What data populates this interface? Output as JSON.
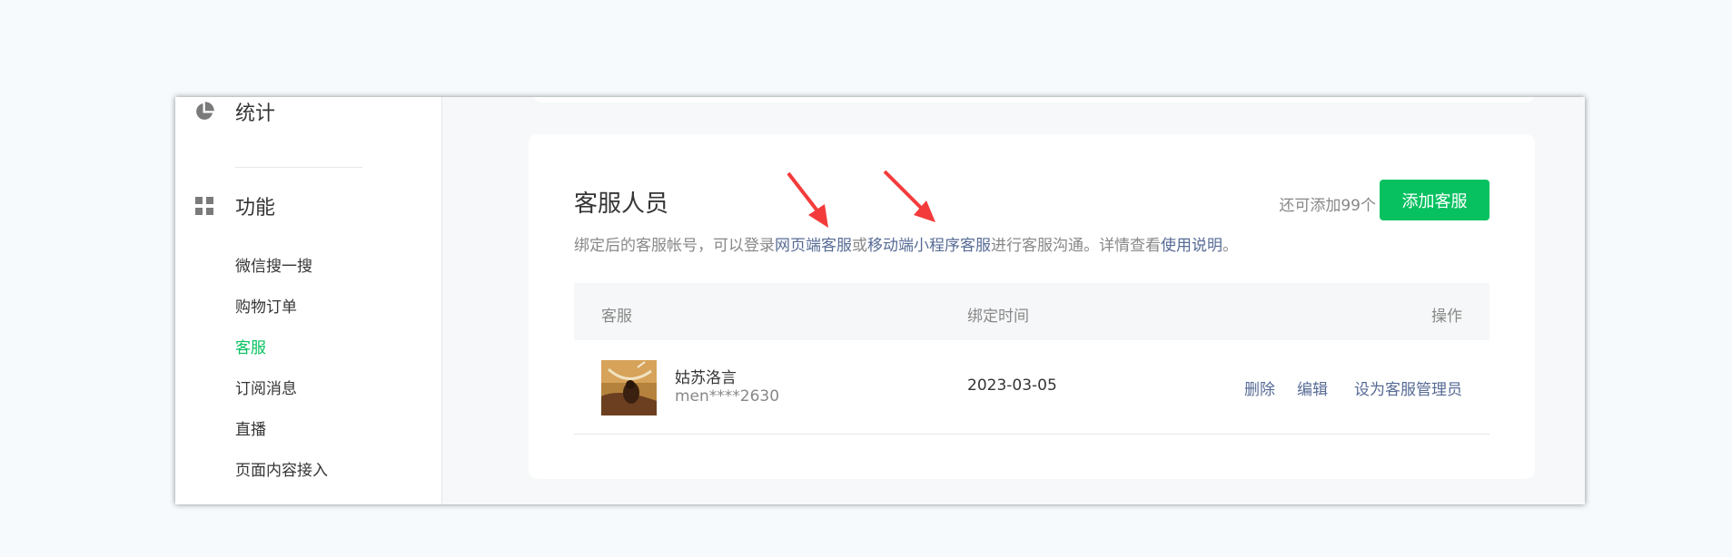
{
  "sidebar": {
    "stats_label": "统计",
    "features_label": "功能",
    "items": [
      {
        "label": "微信搜一搜"
      },
      {
        "label": "购物订单"
      },
      {
        "label": "客服"
      },
      {
        "label": "订阅消息"
      },
      {
        "label": "直播"
      },
      {
        "label": "页面内容接入"
      }
    ],
    "active_item": "客服"
  },
  "card": {
    "title": "客服人员",
    "remaining_text": "还可添加99个",
    "add_button_label": "添加客服",
    "desc_prefix": "绑定后的客服帐号，可以登录",
    "desc_link_web": "网页端客服",
    "desc_or": "或",
    "desc_link_mobile": "移动端小程序客服",
    "desc_middle": "进行客服沟通。详情查看",
    "desc_link_help": "使用说明",
    "desc_suffix": "。"
  },
  "table": {
    "columns": [
      "客服",
      "绑定时间",
      "操作"
    ],
    "rows": [
      {
        "name": "姑苏洛言",
        "account": "men****2630",
        "bind_date": "2023-03-05",
        "actions": [
          "删除",
          "编辑",
          "设为客服管理员"
        ]
      }
    ]
  },
  "colors": {
    "accent": "#07c160",
    "link": "#576b95",
    "annotation_arrow": "#f33b3b"
  },
  "icons": {
    "stats": "pie-chart-icon",
    "features": "grid-icon"
  }
}
